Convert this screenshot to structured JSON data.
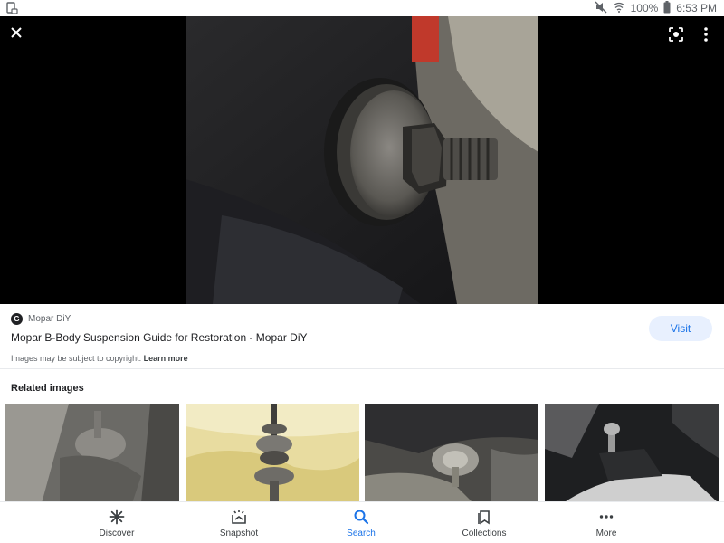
{
  "status_bar": {
    "battery_percent": "100%",
    "time": "6:53 PM"
  },
  "viewer": {
    "close_icon": "close-icon",
    "lens_icon": "lens-icon",
    "more_icon": "more-vert-icon"
  },
  "result": {
    "source_logo_letter": "G",
    "source_name": "Mopar DiY",
    "title": "Mopar B-Body Suspension Guide for Restoration - Mopar DiY",
    "copyright_text": "Images may be subject to copyright.",
    "learn_more": "Learn more",
    "visit_label": "Visit"
  },
  "related": {
    "heading": "Related images"
  },
  "bottom_nav": {
    "items": [
      {
        "label": "Discover",
        "icon": "asterisk-icon"
      },
      {
        "label": "Snapshot",
        "icon": "snapshot-icon"
      },
      {
        "label": "Search",
        "icon": "search-icon"
      },
      {
        "label": "Collections",
        "icon": "bookmark-icon"
      },
      {
        "label": "More",
        "icon": "more-horiz-icon"
      }
    ],
    "active_index": 2
  },
  "colors": {
    "accent": "#1a73e8",
    "visit_bg": "#e8f0fe"
  }
}
